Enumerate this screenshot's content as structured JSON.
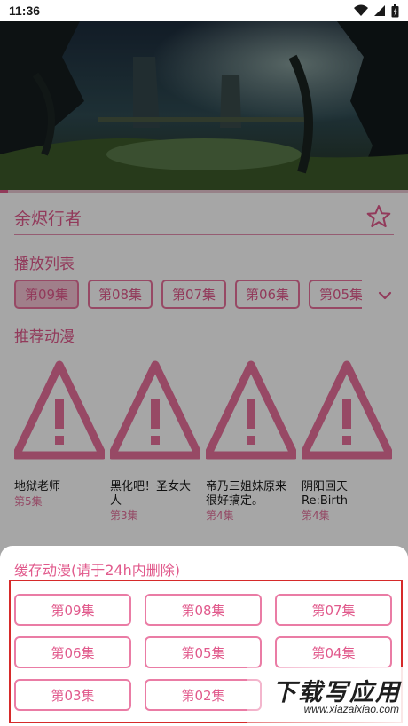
{
  "status_bar": {
    "time": "11:36"
  },
  "video": {
    "progress": 0.02
  },
  "anime": {
    "title": "余烬行者"
  },
  "playlist": {
    "label": "播放列表",
    "episodes": [
      "第09集",
      "第08集",
      "第07集",
      "第06集",
      "第05集"
    ],
    "active_index": 0
  },
  "recommend": {
    "label": "推荐动漫",
    "items": [
      {
        "name": "地狱老师",
        "episode": "第5集"
      },
      {
        "name": "黑化吧！圣女大人",
        "episode": "第3集"
      },
      {
        "name": "帝乃三姐妹原来很好搞定。",
        "episode": "第4集"
      },
      {
        "name": "阴阳回天 Re:Birth",
        "episode": "第4集"
      }
    ]
  },
  "download_sheet": {
    "title": "缓存动漫(请于24h内删除)",
    "episodes": [
      "第09集",
      "第08集",
      "第07集",
      "第06集",
      "第05集",
      "第04集",
      "第03集",
      "第02集"
    ]
  },
  "watermark": {
    "main": "下载写应用",
    "sub": "www.xiazaixiao.com"
  },
  "colors": {
    "accent": "#e15a8c",
    "chip_border": "#e8709c",
    "chip_active": "#f6c3d5",
    "highlight": "#d62a2a"
  },
  "icons": {
    "star": "star-outline-icon",
    "expand": "chevron-down-icon",
    "placeholder": "warning-triangle-icon"
  }
}
